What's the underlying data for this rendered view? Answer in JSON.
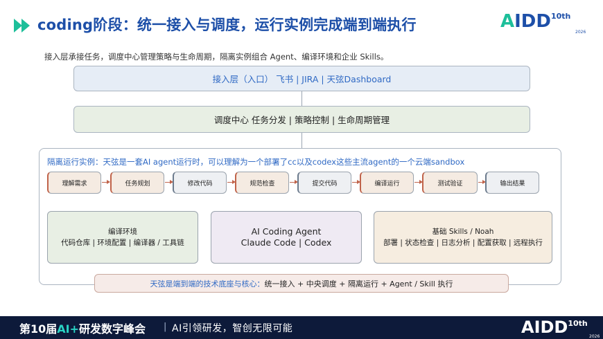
{
  "header": {
    "title": "coding阶段：统一接入与调度，运行实例完成端到端执行",
    "logo": {
      "text_a": "A",
      "text_rest": "IDD",
      "sup": "10",
      "sup_suffix": "th",
      "year": "2026"
    }
  },
  "subtitle": "接入层承接任务，调度中心管理策略与生命周期，隔离实例组合 Agent、编译环境和企业 Skills。",
  "layers": {
    "access": "接入层（入口）    飞书 | JIRA | 天弦Dashboard",
    "dispatch": "调度中心    任务分发 | 策略控制 | 生命周期管理"
  },
  "runtime": {
    "label": "隔离运行实例：天弦是一套AI agent运行时，可以理解为一个部署了cc以及codex这些主流agent的一个云端sandbox",
    "steps": [
      "理解需求",
      "任务规划",
      "修改代码",
      "规范检查",
      "提交代码",
      "编译运行",
      "测试验证",
      "输出结果"
    ],
    "blocks": {
      "build": {
        "line1": "编译环境",
        "line2": "代码仓库 | 环境配置 | 编译器 / 工具链"
      },
      "agent": {
        "line1": "AI Coding Agent",
        "line2": "Claude Code | Codex"
      },
      "base": {
        "line1": "基础 Skills / Noah",
        "line2": "部署 | 状态检查 | 日志分析 | 配置获取 | 远程执行"
      }
    }
  },
  "foundation": {
    "highlight": "天弦是端到端的技术底座与核心：",
    "text": "统一接入 + 中央调度 + 隔离运行 + Agent / Skill 执行"
  },
  "footer": {
    "event_prefix": "第10届",
    "event_accent": "AI+",
    "event_suffix": "研发数字峰会",
    "separator": "|",
    "slogan": "AI引领研发，智创无限可能",
    "logo": {
      "text_a": "A",
      "text_rest": "IDD",
      "sup": "10",
      "sup_suffix": "th",
      "year": "2026"
    }
  },
  "colors": {
    "title_blue": "#1d4fa8",
    "accent_blue": "#2f69c4",
    "step_arrow": "#c0634a",
    "footer_bg": "#0d1a3a",
    "logo_green": "#1dbf9a"
  },
  "icons": {
    "header": "double-play-arrow-icon"
  }
}
